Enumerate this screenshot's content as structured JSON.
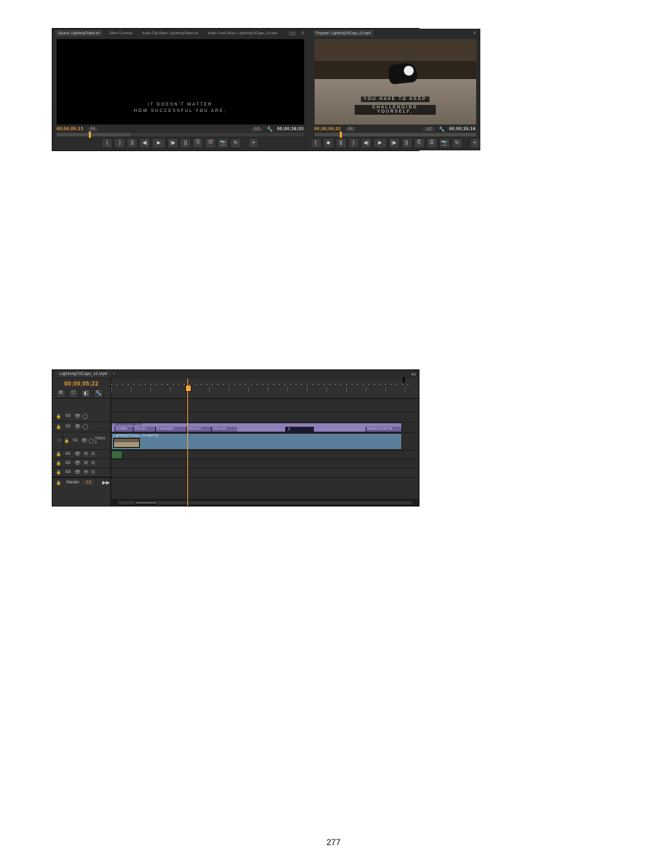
{
  "page_number": "277",
  "source_panel": {
    "tabs": [
      "Source: LightningTrailer.srt",
      "Effect Controls",
      "Audio Clip Mixer: LightningTrailer.srt",
      "Audio Track Mixer: LightningTriCaps_v2.mp4"
    ],
    "overlay_line1": "IT DOESN'T MATTER",
    "overlay_line2": "HOW SUCCESSFUL YOU ARE,",
    "timecode_left": "00;00;05;13",
    "fit_label": "Fit",
    "half_label": "1/2",
    "timecode_right": "00;00;38;03"
  },
  "program_panel": {
    "tab": "Program: LightningTriCaps_v2.mp4",
    "caption_line1": "YOU HAVE TO KEEP",
    "caption_line2": "CHALLENGING YOURSELF,",
    "timecode_left": "00;00;05;22",
    "fit_label": "Fit",
    "half_label": "1/2",
    "timecode_right": "00;00;35;16"
  },
  "timeline": {
    "tab": "LightningTriCaps_v2.mp4",
    "playhead_tc": "00;00;05;22",
    "tracks": {
      "v3": "V3",
      "v2": "V2",
      "v1": "V1",
      "v1_name": "Video 1",
      "a1": "A1",
      "a2": "A2",
      "a3": "A3",
      "patch_v1": "V1",
      "master": "Master",
      "master_db": "0.0"
    },
    "srt_clip_name": "LightningTrailer.srt",
    "captions": {
      "c1": "IN ORD",
      "c2": "YOU HA",
      "c3": "IT DOESN'T",
      "c4": "YOU HAV",
      "c5": "YOU HAV",
      "num": "2",
      "last": "WHEN I'M SITTIN"
    },
    "video_clip_name": "LightningTriCaps_v2.mp4 [V]"
  }
}
